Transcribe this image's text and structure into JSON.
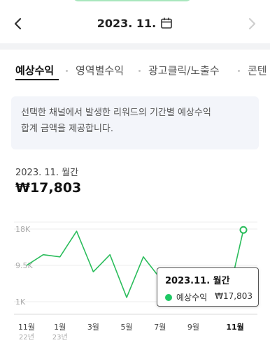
{
  "header": {
    "date": "2023. 11.",
    "prev_icon": "chevron-left-icon",
    "next_icon": "chevron-right-icon",
    "calendar_icon": "calendar-icon"
  },
  "tabs": [
    {
      "label": "예상수익",
      "active": true
    },
    {
      "label": "영역별수익",
      "active": false
    },
    {
      "label": "광고클릭/노출수",
      "active": false
    },
    {
      "label": "콘텐",
      "active": false
    }
  ],
  "info": {
    "line1": "선택한 채널에서 발생한 리워드의 기간별 예상수익",
    "line2": "합계 금액을 제공합니다."
  },
  "summary": {
    "period": "2023. 11. 월간",
    "amount": "₩17,803"
  },
  "colors": {
    "accent": "#1ec864",
    "line": "#2bbd5c",
    "grid": "#ececec"
  },
  "tooltip": {
    "title": "2023.11. 월간",
    "series_name": "예상수익",
    "value": "₩17,803"
  },
  "chart_data": {
    "type": "line",
    "series": [
      {
        "name": "예상수익",
        "values": [
          9500,
          12000,
          11500,
          17500,
          8000,
          12000,
          2000,
          11500,
          6500,
          6000,
          4500,
          3000,
          800,
          17803
        ]
      }
    ],
    "y_ticks": [
      {
        "label": "18K",
        "value": 18000
      },
      {
        "label": "9.5K",
        "value": 9500
      },
      {
        "label": "1K",
        "value": 1000
      }
    ],
    "x_ticks": [
      {
        "label": "11월",
        "sub": "22년",
        "index": 0,
        "bold": false
      },
      {
        "label": "1월",
        "sub": "23년",
        "index": 2,
        "bold": false
      },
      {
        "label": "3월",
        "sub": "",
        "index": 4,
        "bold": false
      },
      {
        "label": "5월",
        "sub": "",
        "index": 6,
        "bold": false
      },
      {
        "label": "7월",
        "sub": "",
        "index": 8,
        "bold": false
      },
      {
        "label": "9월",
        "sub": "",
        "index": 10,
        "bold": false
      },
      {
        "label": "11월",
        "sub": "",
        "index": 12.5,
        "bold": true
      }
    ],
    "ylim": [
      1000,
      18000
    ],
    "highlight_index": 13
  }
}
